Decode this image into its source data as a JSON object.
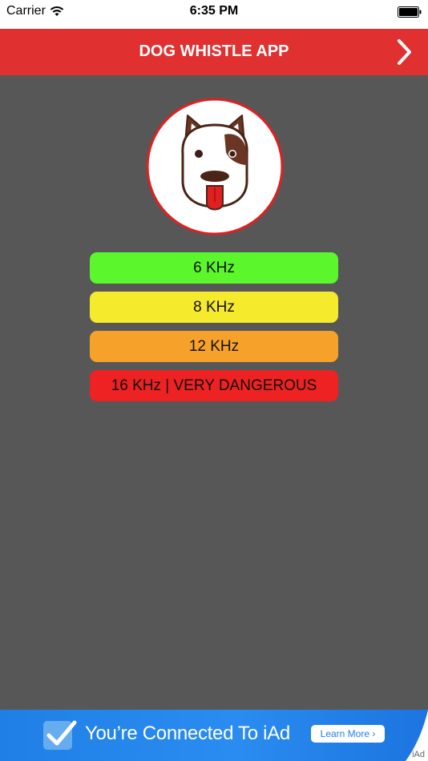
{
  "status_bar": {
    "carrier": "Carrier",
    "time": "6:35 PM",
    "wifi_icon": "wifi-icon",
    "battery_icon": "battery-icon"
  },
  "header": {
    "title": "DOG WHISTLE APP",
    "next_icon": "chevron-right-icon",
    "background": "#e03030"
  },
  "logo": {
    "icon": "dog-face-icon"
  },
  "frequencies": [
    {
      "label": "6 KHz",
      "color": "#5cf62c"
    },
    {
      "label": "8 KHz",
      "color": "#f6ea2c"
    },
    {
      "label": "12 KHz",
      "color": "#f6a22a"
    },
    {
      "label": "16 KHz  |  VERY DANGEROUS",
      "color": "#ee2222"
    }
  ],
  "ad": {
    "text": "You’re Connected To iAd",
    "button": "Learn More ›",
    "mark": "iAd",
    "icon": "checkmark-icon"
  }
}
